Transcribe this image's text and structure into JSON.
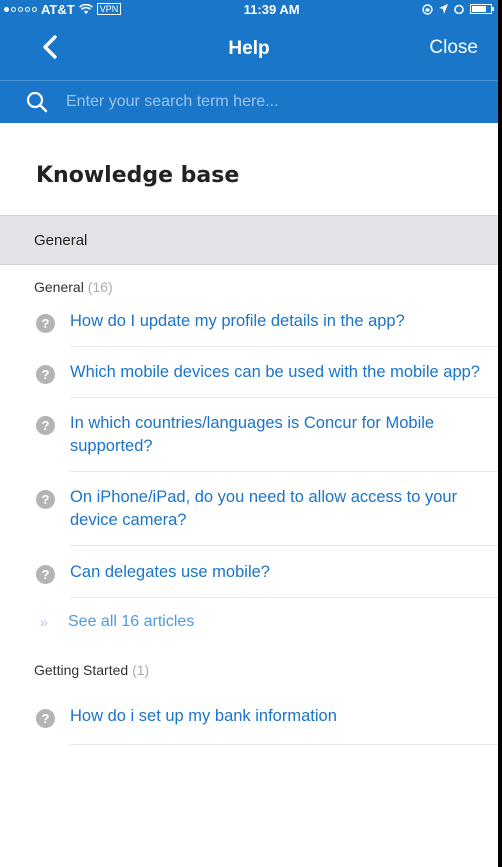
{
  "status_bar": {
    "carrier": "AT&T",
    "vpn": "VPN",
    "time": "11:39 AM"
  },
  "nav": {
    "title": "Help",
    "close_label": "Close"
  },
  "search": {
    "placeholder": "Enter your search term here..."
  },
  "page": {
    "title": "Knowledge base"
  },
  "section": {
    "header": "General"
  },
  "groups": [
    {
      "label": "General",
      "count": "(16)",
      "articles": [
        "How do I update my profile details in the app?",
        "Which mobile devices can be used with the mobile app?",
        "In which countries/languages is Concur for Mobile supported?",
        "On iPhone/iPad, do you need to allow access to your device camera?",
        "Can delegates use mobile?"
      ],
      "see_all": "See all 16 articles"
    },
    {
      "label": "Getting Started",
      "count": "(1)",
      "articles": [
        "How do i set up my bank information"
      ]
    }
  ],
  "icons": {
    "question": "?",
    "chevrons": "»"
  },
  "colors": {
    "brand_blue": "#1976c9",
    "link_blue": "#1a74c7",
    "section_gray": "#e1e3e7"
  }
}
